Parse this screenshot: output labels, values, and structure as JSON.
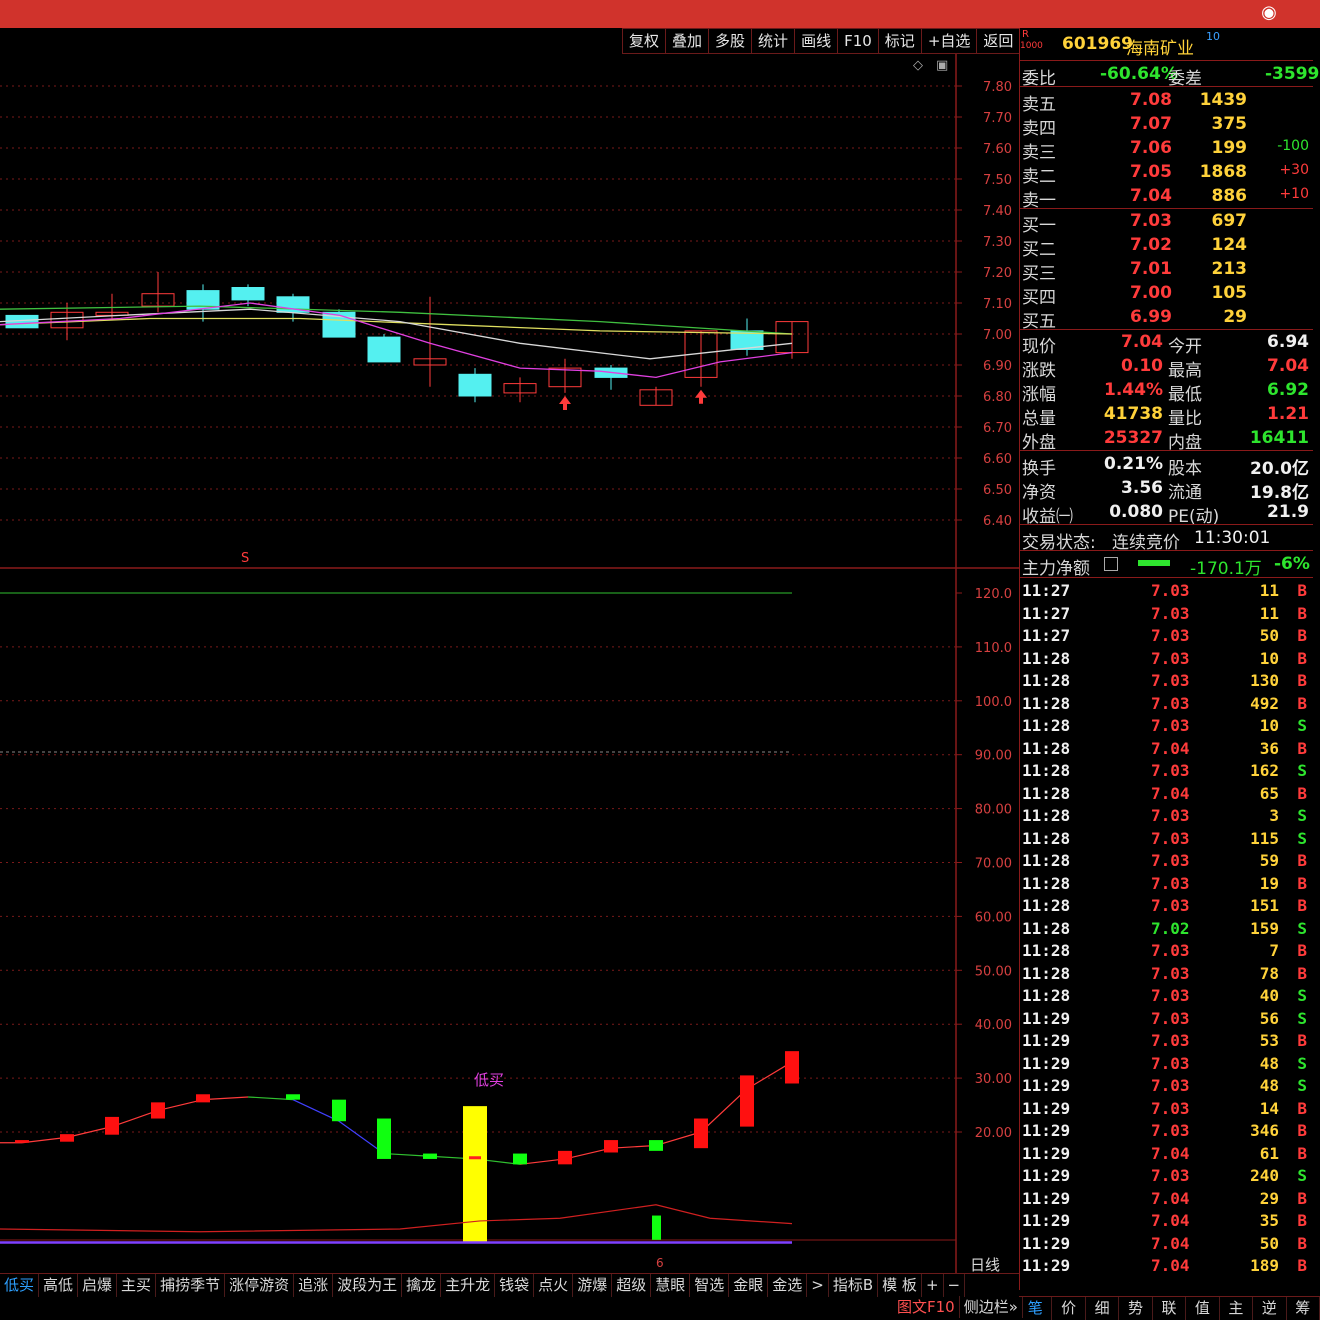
{
  "toolbar": [
    "复权",
    "叠加",
    "多股",
    "统计",
    "画线",
    "F10",
    "标记",
    "+自选",
    "返回"
  ],
  "stock": {
    "code": "601969",
    "name": "海南矿业",
    "badge_top": "R",
    "badge_bottom": "1000",
    "sup": "10"
  },
  "weibi": {
    "label": "委比",
    "value": "-60.64%",
    "label2": "委差",
    "value2": "-3599"
  },
  "asks": [
    {
      "label": "卖五",
      "price": "7.08",
      "vol": "1439",
      "chg": ""
    },
    {
      "label": "卖四",
      "price": "7.07",
      "vol": "375",
      "chg": ""
    },
    {
      "label": "卖三",
      "price": "7.06",
      "vol": "199",
      "chg": "-100"
    },
    {
      "label": "卖二",
      "price": "7.05",
      "vol": "1868",
      "chg": "+30"
    },
    {
      "label": "卖一",
      "price": "7.04",
      "vol": "886",
      "chg": "+10"
    }
  ],
  "bids": [
    {
      "label": "买一",
      "price": "7.03",
      "vol": "697"
    },
    {
      "label": "买二",
      "price": "7.02",
      "vol": "124"
    },
    {
      "label": "买三",
      "price": "7.01",
      "vol": "213"
    },
    {
      "label": "买四",
      "price": "7.00",
      "vol": "105"
    },
    {
      "label": "买五",
      "price": "6.99",
      "vol": "29"
    }
  ],
  "quote": [
    {
      "l1": "现价",
      "v1": "7.04",
      "c1": "red",
      "l2": "今开",
      "v2": "6.94",
      "c2": "wht"
    },
    {
      "l1": "涨跌",
      "v1": "0.10",
      "c1": "red",
      "l2": "最高",
      "v2": "7.04",
      "c2": "red"
    },
    {
      "l1": "涨幅",
      "v1": "1.44%",
      "c1": "red",
      "l2": "最低",
      "v2": "6.92",
      "c2": "green"
    },
    {
      "l1": "总量",
      "v1": "41738",
      "c1": "yel",
      "l2": "量比",
      "v2": "1.21",
      "c2": "red"
    },
    {
      "l1": "外盘",
      "v1": "25327",
      "c1": "red",
      "l2": "内盘",
      "v2": "16411",
      "c2": "green"
    }
  ],
  "stats": [
    {
      "l1": "换手",
      "v1": "0.21%",
      "l2": "股本",
      "v2": "20.0亿"
    },
    {
      "l1": "净资",
      "v1": "3.56",
      "l2": "流通",
      "v2": "19.8亿"
    },
    {
      "l1": "收益㈠",
      "v1": "0.080",
      "l2": "PE(动)",
      "v2": "21.9"
    }
  ],
  "trade_status": {
    "label": "交易状态:",
    "value": "连续竞价",
    "time": "11:30:01"
  },
  "main_net": {
    "label": "主力净额",
    "value": "-170.1万",
    "pct": "-6%"
  },
  "ticks": [
    [
      "11:27",
      "7.03",
      "11",
      "B"
    ],
    [
      "11:27",
      "7.03",
      "11",
      "B"
    ],
    [
      "11:27",
      "7.03",
      "50",
      "B"
    ],
    [
      "11:28",
      "7.03",
      "10",
      "B"
    ],
    [
      "11:28",
      "7.03",
      "130",
      "B"
    ],
    [
      "11:28",
      "7.03",
      "492",
      "B"
    ],
    [
      "11:28",
      "7.03",
      "10",
      "S"
    ],
    [
      "11:28",
      "7.04",
      "36",
      "B"
    ],
    [
      "11:28",
      "7.03",
      "162",
      "S"
    ],
    [
      "11:28",
      "7.04",
      "65",
      "B"
    ],
    [
      "11:28",
      "7.03",
      "3",
      "S"
    ],
    [
      "11:28",
      "7.03",
      "115",
      "S"
    ],
    [
      "11:28",
      "7.03",
      "59",
      "B"
    ],
    [
      "11:28",
      "7.03",
      "19",
      "B"
    ],
    [
      "11:28",
      "7.03",
      "151",
      "B"
    ],
    [
      "11:28",
      "7.02",
      "159",
      "S"
    ],
    [
      "11:28",
      "7.03",
      "7",
      "B"
    ],
    [
      "11:28",
      "7.03",
      "78",
      "B"
    ],
    [
      "11:28",
      "7.03",
      "40",
      "S"
    ],
    [
      "11:29",
      "7.03",
      "56",
      "S"
    ],
    [
      "11:29",
      "7.03",
      "53",
      "B"
    ],
    [
      "11:29",
      "7.03",
      "48",
      "S"
    ],
    [
      "11:29",
      "7.03",
      "48",
      "S"
    ],
    [
      "11:29",
      "7.03",
      "14",
      "B"
    ],
    [
      "11:29",
      "7.03",
      "346",
      "B"
    ],
    [
      "11:29",
      "7.04",
      "61",
      "B"
    ],
    [
      "11:29",
      "7.03",
      "240",
      "S"
    ],
    [
      "11:29",
      "7.04",
      "29",
      "B"
    ],
    [
      "11:29",
      "7.04",
      "35",
      "B"
    ],
    [
      "11:29",
      "7.04",
      "50",
      "B"
    ],
    [
      "11:29",
      "7.04",
      "189",
      "B"
    ]
  ],
  "price_axis": [
    "7.80",
    "7.70",
    "7.60",
    "7.50",
    "7.40",
    "7.30",
    "7.20",
    "7.10",
    "7.00",
    "6.90",
    "6.80",
    "6.70",
    "6.60",
    "6.50",
    "6.40"
  ],
  "ind_axis": [
    "120.0",
    "110.0",
    "100.0",
    "90.00",
    "80.00",
    "70.00",
    "60.00",
    "50.00",
    "40.00",
    "30.00",
    "20.00"
  ],
  "chart_labels": {
    "signal_s": "S",
    "dimai": "低买",
    "xtick": "6",
    "period": "日线"
  },
  "bottom_tabs": [
    "低买",
    "高低",
    "启爆",
    "主买",
    "捕捞季节",
    "涨停游资",
    "追涨",
    "波段为王",
    "擒龙",
    "主升龙",
    "钱袋",
    "点火",
    "游爆",
    "超级",
    "慧眼",
    "智选",
    "金眼",
    "金选",
    ">",
    "指标B",
    "模 板",
    "+",
    "−"
  ],
  "bottom_right": [
    "图文F10",
    "侧边栏»"
  ],
  "side_nav": [
    "笔",
    "价",
    "细",
    "势",
    "联",
    "值",
    "主",
    "逆",
    "筹"
  ],
  "colors": {
    "up": "#ff3b3b",
    "down": "#54f0f0",
    "frame": "#8a1a1a",
    "ma_white": "#d8d8d8",
    "ma_yellow": "#e0e060",
    "ma_magenta": "#e040e0",
    "ma_green": "#40c040"
  }
}
